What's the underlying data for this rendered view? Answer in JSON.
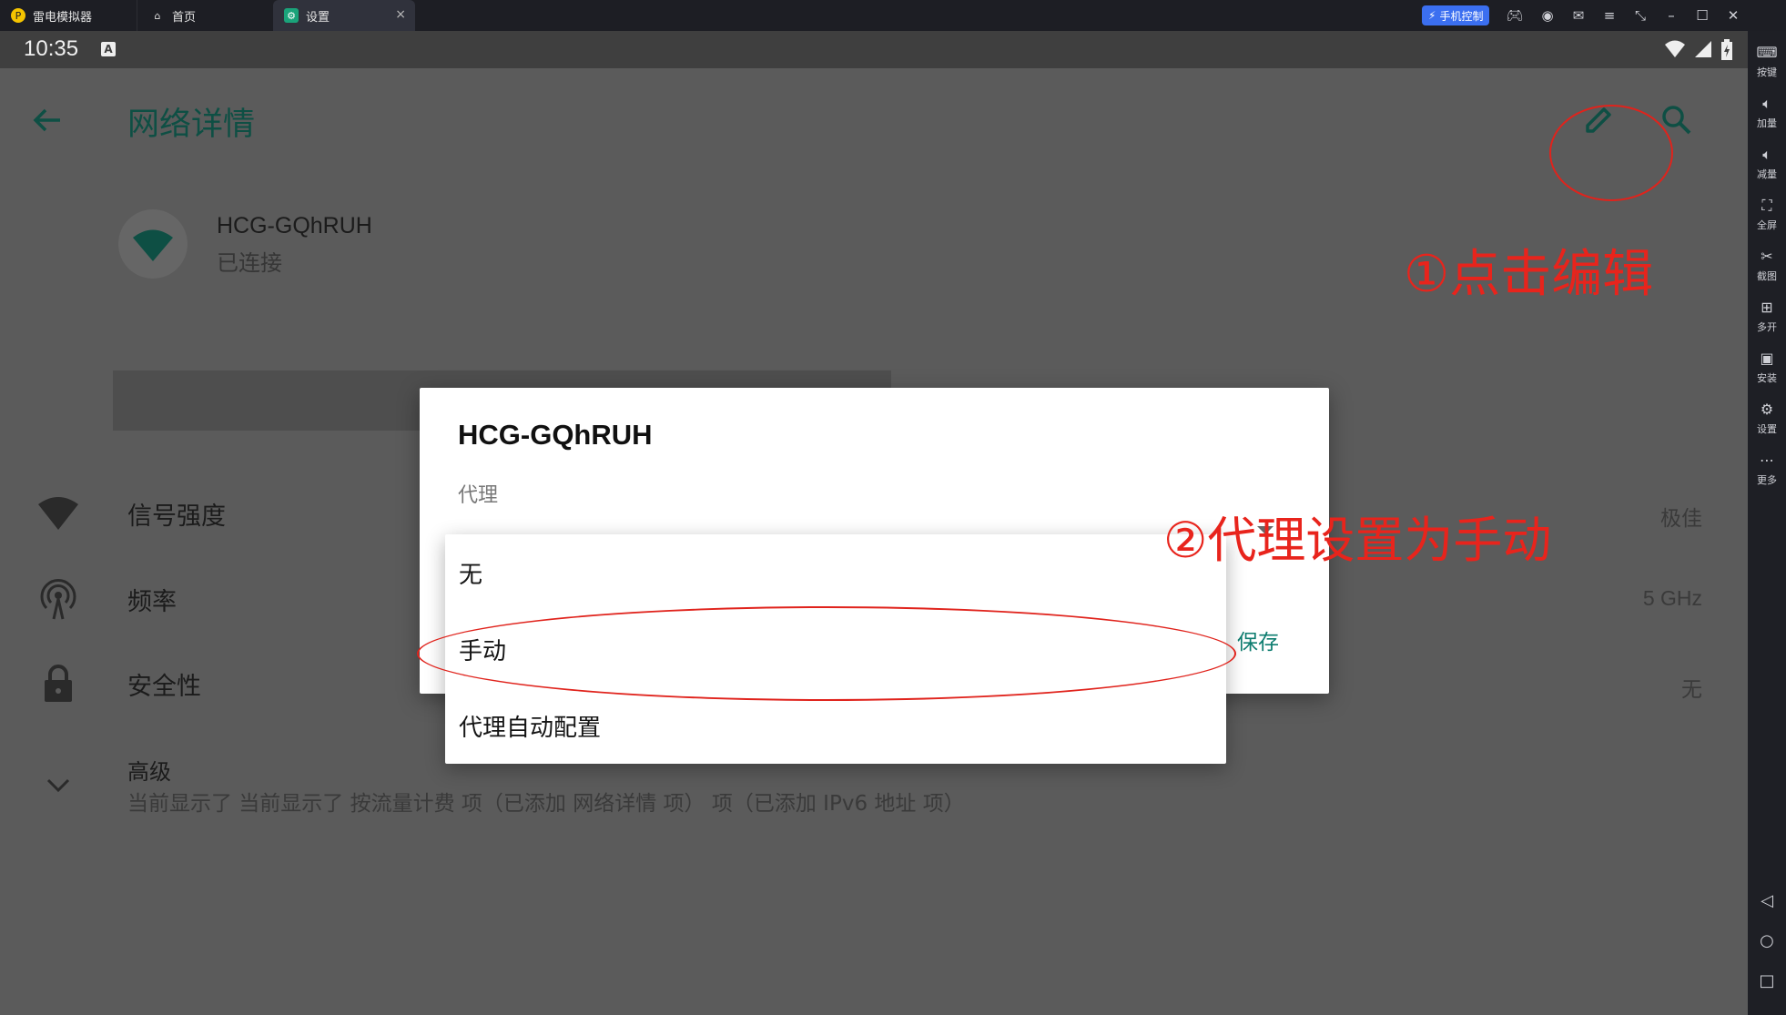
{
  "titlebar": {
    "tabs": [
      {
        "label": "雷电模拟器"
      },
      {
        "label": "首页"
      },
      {
        "label": "设置"
      }
    ],
    "phone_control": "手机控制",
    "icons": [
      "gamepad-icon",
      "account-icon",
      "mail-icon",
      "menu-icon",
      "shrink-icon",
      "minimize-icon",
      "maximize-icon",
      "close-icon"
    ]
  },
  "statusbar": {
    "time": "10:35",
    "badge": "A"
  },
  "appbar": {
    "title": "网络详情"
  },
  "network": {
    "name": "HCG-GQhRUH",
    "status": "已连接"
  },
  "rows": [
    {
      "label": "信号强度",
      "value": "极佳"
    },
    {
      "label": "频率",
      "value": "5 GHz"
    },
    {
      "label": "安全性",
      "value": "无"
    },
    {
      "label": "高级",
      "summary": "当前显示了 当前显示了 按流量计费 项（已添加 网络详情 项） 项（已添加 IPv6 地址 项）"
    }
  ],
  "dialog": {
    "title": "HCG-GQhRUH",
    "proxy_label": "代理",
    "save_label": "保存"
  },
  "menu": {
    "options": [
      {
        "label": "无"
      },
      {
        "label": "手动"
      },
      {
        "label": "代理自动配置"
      }
    ]
  },
  "annotations": {
    "step1": "①点击编辑",
    "step2": "②代理设置为手动",
    "color": "#e8241c"
  },
  "sidebar": {
    "buttons": [
      {
        "label": "按键"
      },
      {
        "label": "加量"
      },
      {
        "label": "减量"
      },
      {
        "label": "全屏"
      },
      {
        "label": "截图"
      },
      {
        "label": "多开"
      },
      {
        "label": "安装"
      },
      {
        "label": "设置"
      },
      {
        "label": "更多"
      }
    ]
  },
  "colors": {
    "accent": "#0e7d70",
    "screen_bg": "#5b5b5b",
    "dialog_bg": "#ffffff"
  }
}
